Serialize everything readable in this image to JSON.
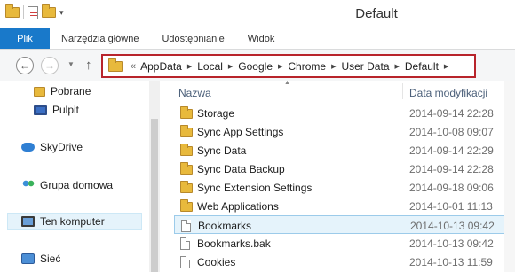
{
  "window": {
    "title": "Default"
  },
  "ribbon": {
    "tabs": [
      "Plik",
      "Narzędzia główne",
      "Udostępnianie",
      "Widok"
    ]
  },
  "address": {
    "overflow": "«",
    "crumbs": [
      "AppData",
      "Local",
      "Google",
      "Chrome",
      "User Data",
      "Default"
    ]
  },
  "nav": {
    "items": [
      {
        "label": "Pobrane",
        "icon": "download-folder-icon"
      },
      {
        "label": "Pulpit",
        "icon": "desktop-icon"
      },
      {
        "label": "SkyDrive",
        "icon": "skydrive-cloud-icon"
      },
      {
        "label": "Grupa domowa",
        "icon": "homegroup-icon"
      },
      {
        "label": "Ten komputer",
        "icon": "computer-icon"
      },
      {
        "label": "Sieć",
        "icon": "network-icon"
      }
    ]
  },
  "columns": {
    "name": "Nazwa",
    "date": "Data modyfikacji"
  },
  "files": [
    {
      "name": "Storage",
      "date": "2014-09-14 22:28",
      "type": "folder"
    },
    {
      "name": "Sync App Settings",
      "date": "2014-10-08 09:07",
      "type": "folder"
    },
    {
      "name": "Sync Data",
      "date": "2014-09-14 22:29",
      "type": "folder"
    },
    {
      "name": "Sync Data Backup",
      "date": "2014-09-14 22:28",
      "type": "folder"
    },
    {
      "name": "Sync Extension Settings",
      "date": "2014-09-18 09:06",
      "type": "folder"
    },
    {
      "name": "Web Applications",
      "date": "2014-10-01 11:13",
      "type": "folder"
    },
    {
      "name": "Bookmarks",
      "date": "2014-10-13 09:42",
      "type": "file",
      "selected": true
    },
    {
      "name": "Bookmarks.bak",
      "date": "2014-10-13 09:42",
      "type": "file"
    },
    {
      "name": "Cookies",
      "date": "2014-10-13 11:59",
      "type": "file"
    }
  ],
  "colors": {
    "accent": "#1979ca",
    "highlight": "#b8242b",
    "selection": "#e5f3fb"
  }
}
